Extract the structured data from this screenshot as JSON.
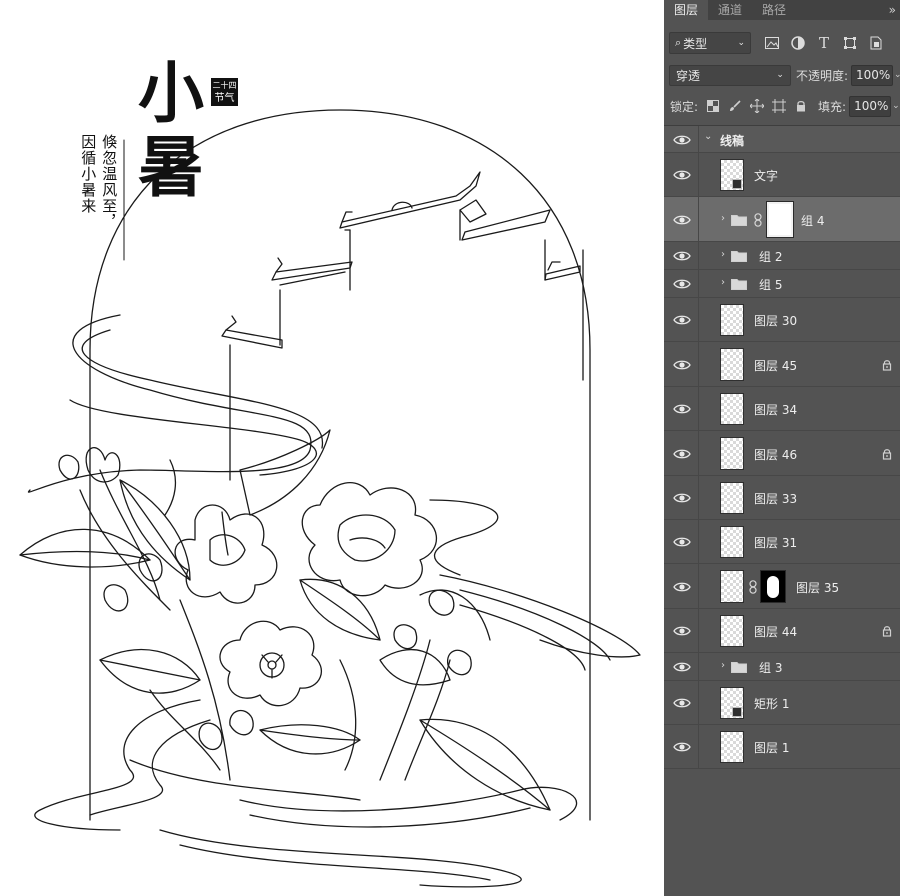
{
  "artwork": {
    "title_chars": [
      "小",
      "暑"
    ],
    "seal_lines": [
      "二十四",
      "节气"
    ],
    "poem_columns": [
      "倏忽温风至，",
      "因循小暑来"
    ]
  },
  "panel": {
    "tabs": [
      {
        "label": "图层",
        "active": true
      },
      {
        "label": "通道",
        "active": false
      },
      {
        "label": "路径",
        "active": false
      }
    ],
    "collapse_label": "»",
    "filter": {
      "kind_label": "类型"
    },
    "blend": {
      "mode": "穿透",
      "opacity_label": "不透明度:",
      "opacity_value": "100%"
    },
    "lock": {
      "label": "锁定:",
      "fill_label": "填充:",
      "fill_value": "100%"
    },
    "layers": [
      {
        "name": "线稿",
        "kind": "group-open",
        "indent": 0,
        "locked": false
      },
      {
        "name": "文字",
        "kind": "smart",
        "indent": 1,
        "locked": false
      },
      {
        "name": "组 4",
        "kind": "group-masked",
        "indent": 1,
        "locked": false,
        "selected": true
      },
      {
        "name": "组 2",
        "kind": "group",
        "indent": 1,
        "locked": false
      },
      {
        "name": "组 5",
        "kind": "group",
        "indent": 1,
        "locked": false
      },
      {
        "name": "图层 30",
        "kind": "pixel",
        "indent": 1,
        "locked": false
      },
      {
        "name": "图层 45",
        "kind": "pixel",
        "indent": 1,
        "locked": true
      },
      {
        "name": "图层 34",
        "kind": "pixel",
        "indent": 1,
        "locked": false
      },
      {
        "name": "图层 46",
        "kind": "pixel",
        "indent": 1,
        "locked": true
      },
      {
        "name": "图层 33",
        "kind": "pixel",
        "indent": 1,
        "locked": false
      },
      {
        "name": "图层 31",
        "kind": "pixel",
        "indent": 1,
        "locked": false
      },
      {
        "name": "图层 35",
        "kind": "pixel-masked",
        "indent": 1,
        "locked": false
      },
      {
        "name": "图层 44",
        "kind": "pixel",
        "indent": 1,
        "locked": true
      },
      {
        "name": "组 3",
        "kind": "group",
        "indent": 1,
        "locked": false
      },
      {
        "name": "矩形 1",
        "kind": "shape",
        "indent": 1,
        "locked": false
      },
      {
        "name": "图层 1",
        "kind": "pixel",
        "indent": 1,
        "locked": false
      }
    ]
  }
}
